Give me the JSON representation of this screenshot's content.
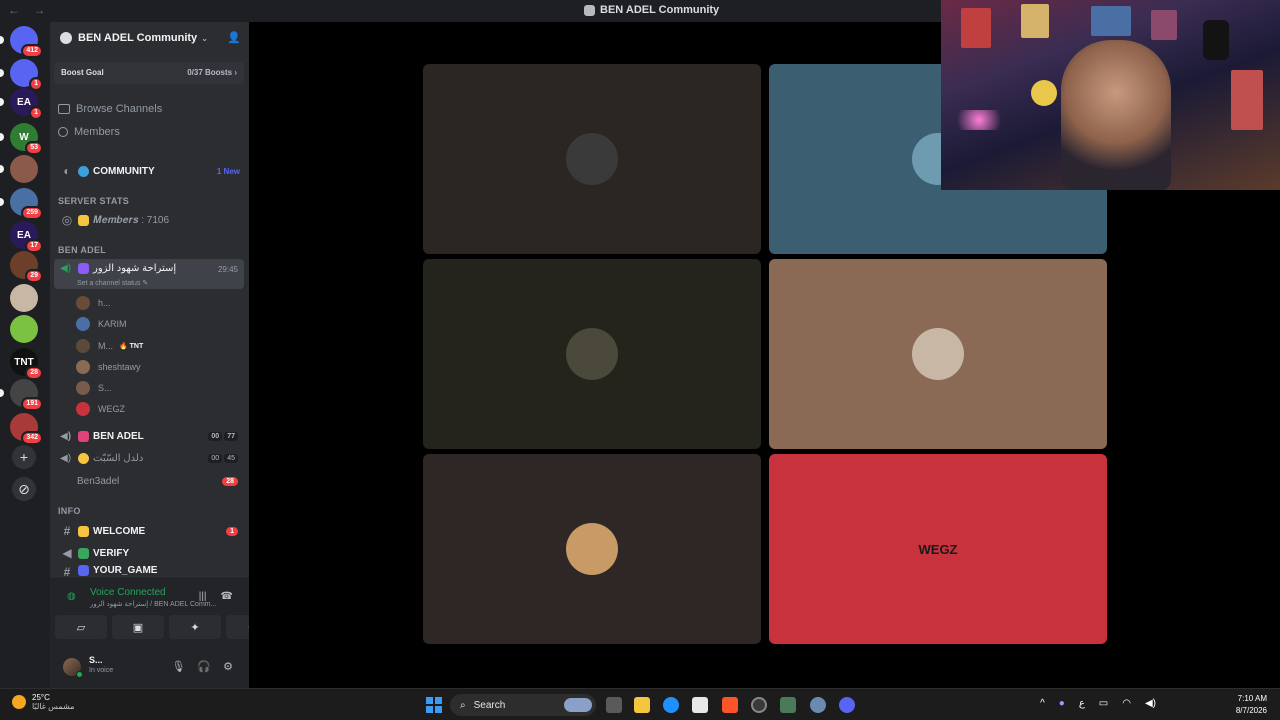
{
  "titlebar": {
    "back": "←",
    "forward": "→",
    "title": "BEN ADEL Community"
  },
  "rail": {
    "servers": [
      {
        "name": "discord-home",
        "badge": "412",
        "color": "#5865f2",
        "glyph": ""
      },
      {
        "name": "discord",
        "badge": "1",
        "color": "#5865f2",
        "glyph": ""
      },
      {
        "name": "ea-1",
        "badge": "1",
        "color": "#2b1a5a",
        "glyph": "EA"
      },
      {
        "name": "w-server",
        "badge": "53",
        "color": "#2e7d32",
        "glyph": "W"
      },
      {
        "name": "server-5",
        "badge": "",
        "color": "#8b5a4a",
        "glyph": ""
      },
      {
        "name": "server-6",
        "badge": "259",
        "color": "#4a6fa5",
        "glyph": ""
      },
      {
        "name": "ea-2",
        "badge": "17",
        "color": "#2b1a5a",
        "glyph": "EA"
      },
      {
        "name": "server-8",
        "badge": "29",
        "color": "#6b3f2a",
        "glyph": ""
      },
      {
        "name": "server-9",
        "badge": "",
        "color": "#c9b7a6",
        "glyph": ""
      },
      {
        "name": "server-10",
        "badge": "",
        "color": "#7cc242",
        "glyph": ""
      },
      {
        "name": "tnt",
        "badge": "28",
        "color": "#111111",
        "glyph": "TNT"
      },
      {
        "name": "server-12",
        "badge": "191",
        "color": "#444444",
        "glyph": ""
      },
      {
        "name": "server-13",
        "badge": "342",
        "color": "#a83a3a",
        "glyph": ""
      }
    ],
    "add_glyph": "+",
    "discover_glyph": "⊘"
  },
  "sidebar": {
    "guild_name": "BEN ADEL Community",
    "boost_label": "Boost Goal",
    "boost_count": "0/37 Boosts ›",
    "browse": "Browse Channels",
    "members": "Members",
    "community": {
      "name": "COMMUNITY",
      "tag": "1 New"
    },
    "server_stats": "SERVER STATS",
    "members_count": "𝑴𝒆𝒎𝒃𝒆𝒓𝒔 : 7106",
    "ben_adel_cat": "BEN ADEL",
    "active_channel": {
      "name": "إستراحة شهود الزور",
      "timer": "29:45",
      "status": "Set a channel status ✎"
    },
    "voice_users": [
      {
        "name": "h...",
        "color": "#6b4a3a"
      },
      {
        "name": "KARIM",
        "color": "#4a6fa5"
      },
      {
        "name": "M...",
        "color": "#5a4a3a",
        "tag": "🔥 TNT"
      },
      {
        "name": "sheshtawy",
        "color": "#8a6a52"
      },
      {
        "name": "S...",
        "color": "#7a5a4a"
      },
      {
        "name": "WEGZ",
        "color": "#c8323c"
      }
    ],
    "ben_adel_chan": {
      "name": "BEN ADEL",
      "p1": "00",
      "p2": "77"
    },
    "dalal_chan": {
      "name": "دلدل السّبّت",
      "p1": "00",
      "p2": "45"
    },
    "ben3adel": {
      "name": "Ben3adel",
      "badge": "28"
    },
    "info_cat": "INFO",
    "welcome": {
      "name": "WELCOME",
      "badge": "1"
    },
    "verify": "VERIFY",
    "your_game": "YOUR_GAME"
  },
  "voice_panel": {
    "title": "Voice Connected",
    "subtitle": "إستراحة شهود الزور / BEN ADEL Comm..."
  },
  "user_panel": {
    "name": "S...",
    "status": "In voice"
  },
  "tiles": [
    {
      "bg": "#2b2622",
      "avatar": "#3a3a3a"
    },
    {
      "bg": "#3b5f70",
      "avatar": "#6f9bb0"
    },
    {
      "bg": "#25241c",
      "avatar": "#4b4a3a"
    },
    {
      "bg": "#8a6a55",
      "avatar": "#c9b7a6"
    },
    {
      "bg": "#2e2726",
      "avatar": "#c79a66"
    },
    {
      "bg": "#c8323c",
      "avatar": "#c8323c",
      "text": "WEGZ"
    }
  ],
  "taskbar": {
    "weather_temp": "25°C",
    "weather_desc": "مشمس غالبًا",
    "search": "Search",
    "time": "7:10 AM",
    "date": "8/7/2026",
    "lang": "ع"
  },
  "colors": {
    "accent": "#5865f2",
    "green": "#23a55a",
    "red": "#f23f43"
  }
}
